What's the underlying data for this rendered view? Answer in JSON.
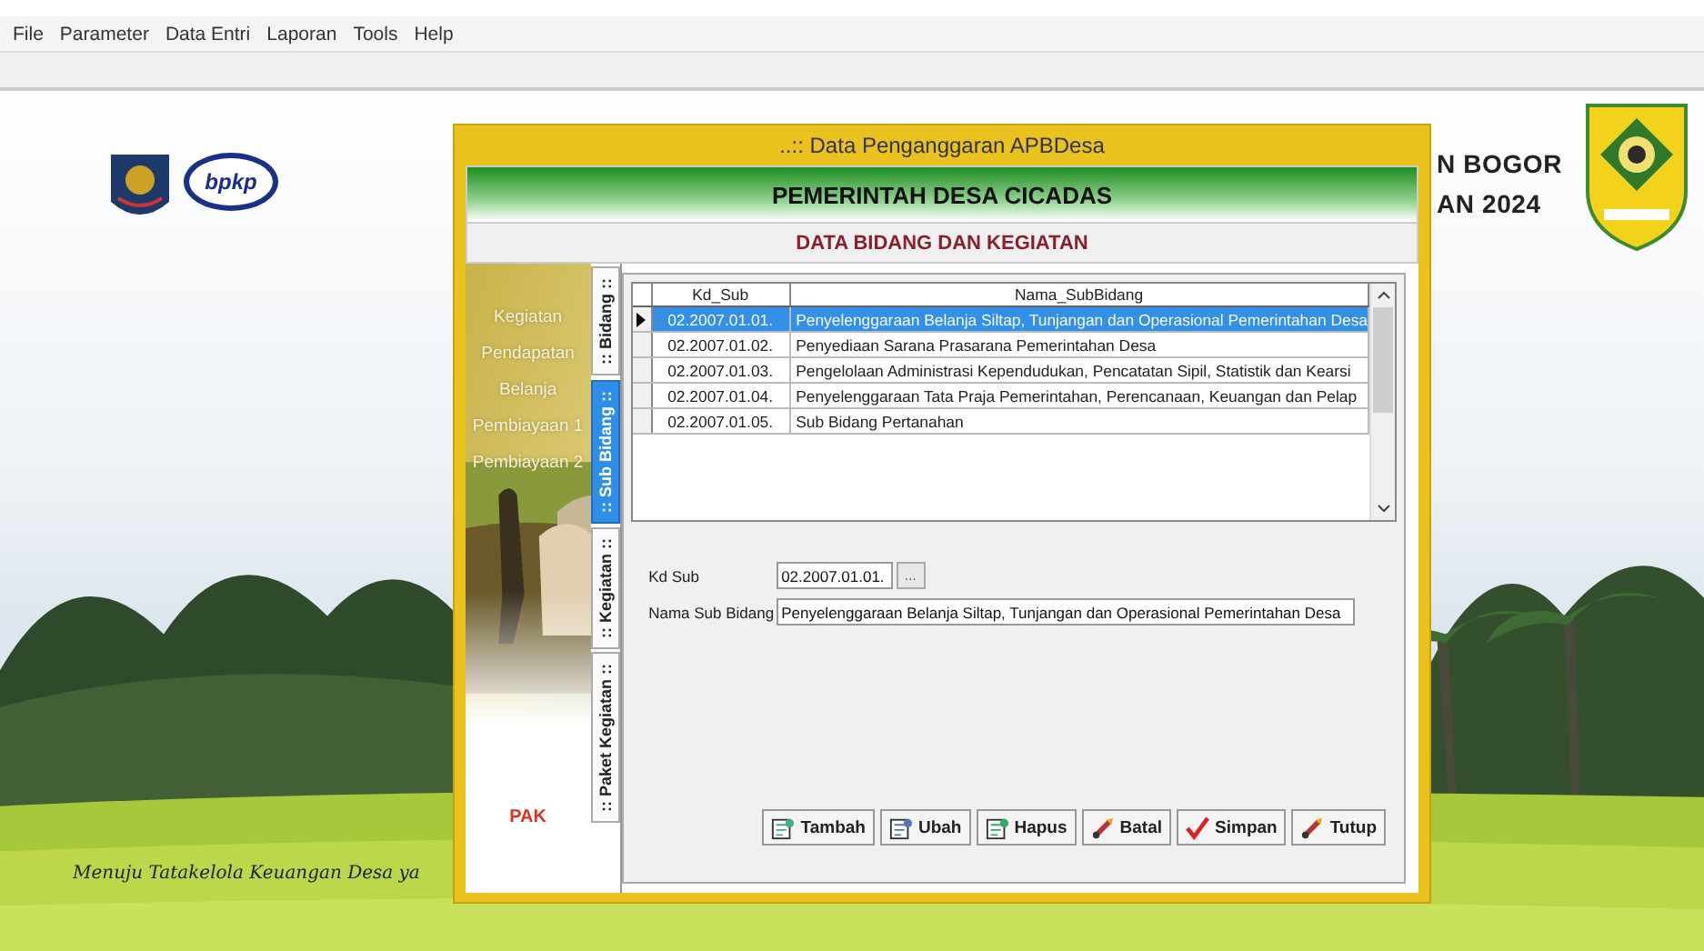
{
  "menu": [
    "File",
    "Parameter",
    "Data Entri",
    "Laporan",
    "Tools",
    "Help"
  ],
  "background": {
    "logo_text": "bpkp",
    "heading_lines": [
      "N BOGOR",
      "AN 2024"
    ],
    "tagline": "Menuju Tatakelola Keuangan Desa ya"
  },
  "dialog": {
    "title": "..:: Data Penganggaran APBDesa",
    "header": "PEMERINTAH DESA CICADAS",
    "subheader": "DATA BIDANG DAN KEGIATAN",
    "side_menu": [
      {
        "label": "Kegiatan",
        "kind": "link"
      },
      {
        "label": "Pendapatan",
        "kind": "link"
      },
      {
        "label": "Belanja",
        "kind": "link"
      },
      {
        "label": "Pembiayaan 1",
        "kind": "link"
      },
      {
        "label": "Pembiayaan 2",
        "kind": "link"
      },
      {
        "label": "PAK",
        "kind": "special"
      }
    ],
    "tabs": [
      {
        "label": ":: Bidang ::",
        "selected": false
      },
      {
        "label": ":: Sub Bidang ::",
        "selected": true
      },
      {
        "label": ":: Kegiatan ::",
        "selected": false
      },
      {
        "label": ":: Paket Kegiatan ::",
        "selected": false
      }
    ],
    "table": {
      "columns": [
        "Kd_Sub",
        "Nama_SubBidang"
      ],
      "rows": [
        {
          "cells": [
            "02.2007.01.01.",
            "Penyelenggaraan Belanja Siltap, Tunjangan dan Operasional Pemerintahan Desa"
          ],
          "selected": true
        },
        {
          "cells": [
            "02.2007.01.02.",
            "Penyediaan Sarana Prasarana Pemerintahan Desa"
          ],
          "selected": false
        },
        {
          "cells": [
            "02.2007.01.03.",
            "Pengelolaan Administrasi Kependudukan, Pencatatan Sipil, Statistik dan Kearsi"
          ],
          "selected": false
        },
        {
          "cells": [
            "02.2007.01.04.",
            "Penyelenggaraan Tata Praja Pemerintahan, Perencanaan, Keuangan dan Pelap"
          ],
          "selected": false
        },
        {
          "cells": [
            "02.2007.01.05.",
            "Sub Bidang Pertanahan"
          ],
          "selected": false
        }
      ]
    },
    "form": [
      {
        "label": "Kd Sub",
        "value": "02.2007.01.01.",
        "browse": "..."
      },
      {
        "label": "Nama Sub Bidang",
        "value": "Penyelenggaraan Belanja Siltap, Tunjangan dan Operasional Pemerintahan Desa"
      }
    ],
    "buttons": [
      {
        "label": "Tambah",
        "kind": "add"
      },
      {
        "label": "Ubah",
        "kind": "edit"
      },
      {
        "label": "Hapus",
        "kind": "delete"
      },
      {
        "label": "Batal",
        "kind": "cancel"
      },
      {
        "label": "Simpan",
        "kind": "save"
      },
      {
        "label": "Tutup",
        "kind": "close"
      }
    ]
  }
}
